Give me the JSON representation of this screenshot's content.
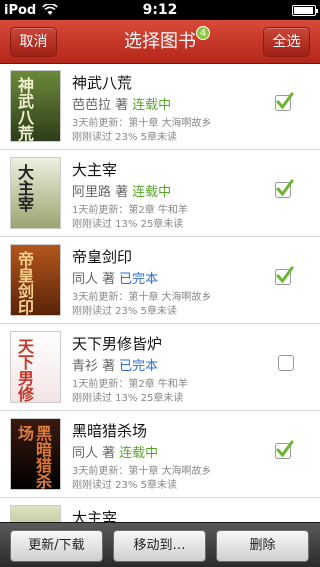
{
  "status_bar": {
    "carrier": "iPod",
    "time": "9:12",
    "battery_level": 0.95,
    "icons": [
      "wifi-icon",
      "battery-icon"
    ]
  },
  "navbar": {
    "left_button": "取消",
    "title": "选择图书",
    "badge": "4",
    "right_button": "全选"
  },
  "colors": {
    "accent": "#c0392b",
    "status_serializing": "#59a52c",
    "status_completed": "#2f6fcf",
    "check": "#6bb62e"
  },
  "books": [
    {
      "title": "神武八荒",
      "author": "芭芭拉 著",
      "status": "连载中",
      "status_type": "serializing",
      "update": "3天前更新：第十章 大海啊故乡",
      "progress": "刚刚读过 23%  5章未读",
      "checked": true,
      "cover_text": "神武八荒"
    },
    {
      "title": "大主宰",
      "author": "阿里路 著",
      "status": "连载中",
      "status_type": "serializing",
      "update": "1天前更新：第2章 牛和羊",
      "progress": "刚刚读过 13%  25章未读",
      "checked": true,
      "cover_text": "大主宰"
    },
    {
      "title": "帝皇剑印",
      "author": "同人 著",
      "status": "已完本",
      "status_type": "completed",
      "update": "3天前更新：第十章 大海啊故乡",
      "progress": "刚刚读过 23%  5章未读",
      "checked": true,
      "cover_text": "帝皇剑印"
    },
    {
      "title": "天下男修皆炉",
      "author": "青衫 著",
      "status": "已完本",
      "status_type": "completed",
      "update": "1天前更新：第2章 牛和羊",
      "progress": "刚刚读过 13%  25章未读",
      "checked": false,
      "cover_text": "天下男修"
    },
    {
      "title": "黑暗猎杀场",
      "author": "同人 著",
      "status": "连载中",
      "status_type": "serializing",
      "update": "3天前更新：第十章 大海啊故乡",
      "progress": "刚刚读过 23%  5章未读",
      "checked": true,
      "cover_text": "黑暗猎杀场"
    },
    {
      "title": "大主宰",
      "author": "",
      "status": "",
      "status_type": "",
      "update": "",
      "progress": "",
      "checked": false,
      "cover_text": ""
    }
  ],
  "toolbar": {
    "update_download": "更新/下载",
    "move_to": "移动到…",
    "delete": "删除"
  }
}
